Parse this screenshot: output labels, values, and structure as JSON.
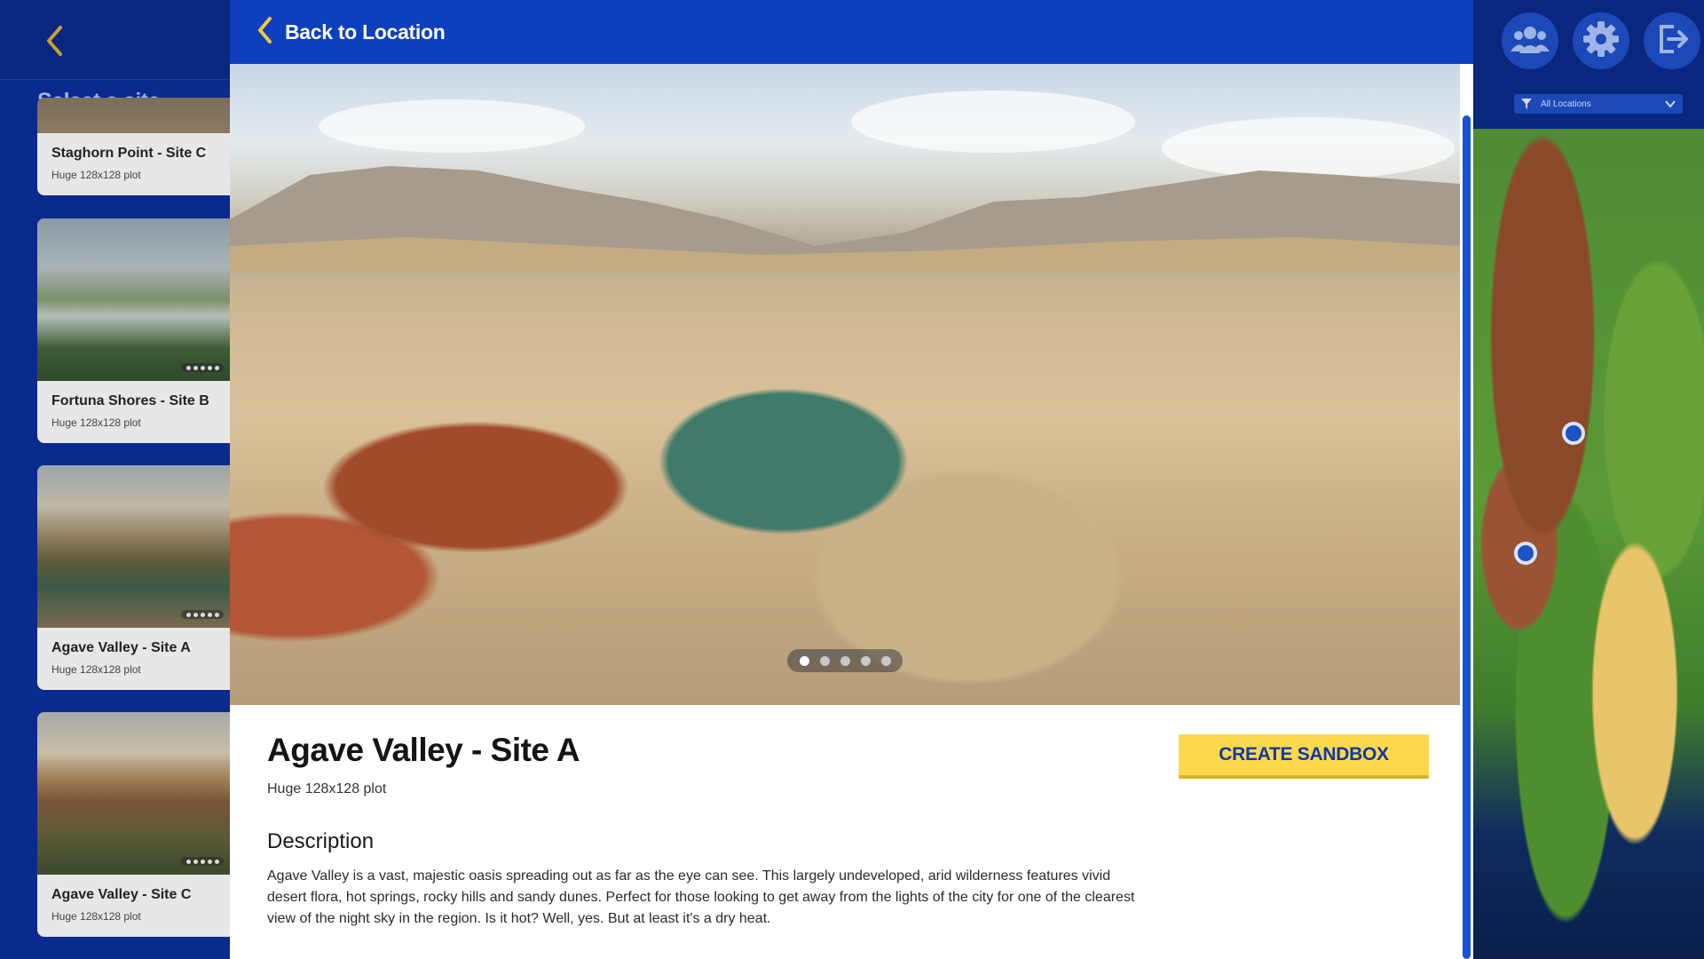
{
  "left_panel": {
    "title": "Select a site",
    "sites": [
      {
        "name": "Staghorn Point - Site C",
        "size": "Huge 128x128 plot"
      },
      {
        "name": "Fortuna Shores - Site B",
        "size": "Huge 128x128 plot"
      },
      {
        "name": "Agave Valley - Site A",
        "size": "Huge 128x128 plot"
      },
      {
        "name": "Agave Valley - Site C",
        "size": "Huge 128x128 plot"
      }
    ]
  },
  "right_panel": {
    "filter_value": "All Locations",
    "icons": [
      "friends-icon",
      "settings-gear-icon",
      "exit-icon"
    ]
  },
  "modal": {
    "back_label": "Back to Location",
    "site_title": "Agave Valley - Site A",
    "site_size": "Huge 128x128 plot",
    "create_button": "CREATE SANDBOX",
    "description_heading": "Description",
    "description": "Agave Valley is a vast, majestic oasis spreading out as far as the eye can see. This largely undeveloped, arid wilderness features vivid desert flora, hot springs, rocky hills and sandy dunes. Perfect for those looking to get away from the lights of the city for one of the clearest view of the night sky in the region. Is it hot? Well, yes. But at least it's a dry heat.",
    "gallery": {
      "total_images": 5,
      "active_index": 0
    }
  },
  "colors": {
    "header_blue": "#0d3fbf",
    "accent_yellow": "#fcd94a",
    "button_text_blue": "#1238a8",
    "background_blue": "#0b2a8e"
  }
}
